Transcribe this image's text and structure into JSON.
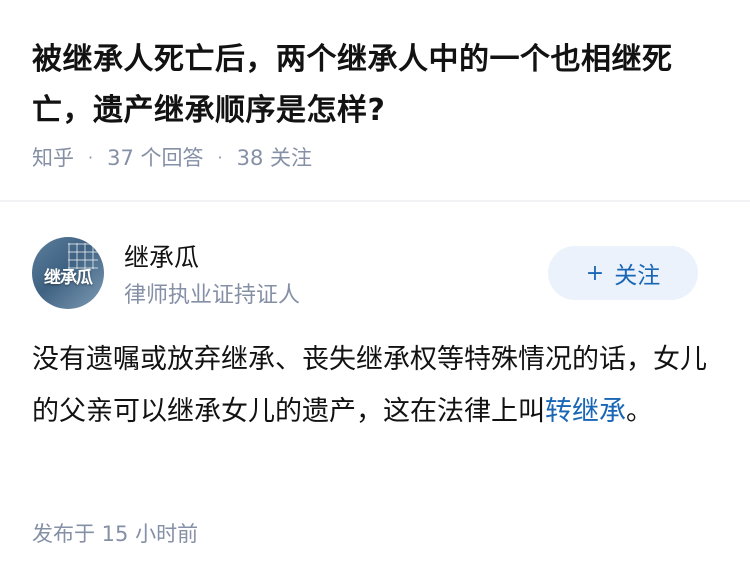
{
  "question": {
    "title": "被继承人死亡后，两个继承人中的一个也相继死亡，遗产继承顺序是怎样?",
    "source": "知乎",
    "answers_count": "37 个回答",
    "followers_count": "38 关注"
  },
  "answer": {
    "avatar_text": "继承瓜",
    "author_name": "继承瓜",
    "author_title": "律师执业证持证人",
    "follow_label": "关注",
    "content_before_link": "没有遗嘱或放弃继承、丧失继承权等特殊情况的话，女儿的父亲可以继承女儿的遗产，这在法律上叫",
    "content_link": "转继承",
    "content_after_link": "。",
    "published": "发布于 15 小时前"
  },
  "colors": {
    "link": "#1a66b6",
    "meta": "#8590a6",
    "follow_bg": "#ebf2fb"
  }
}
